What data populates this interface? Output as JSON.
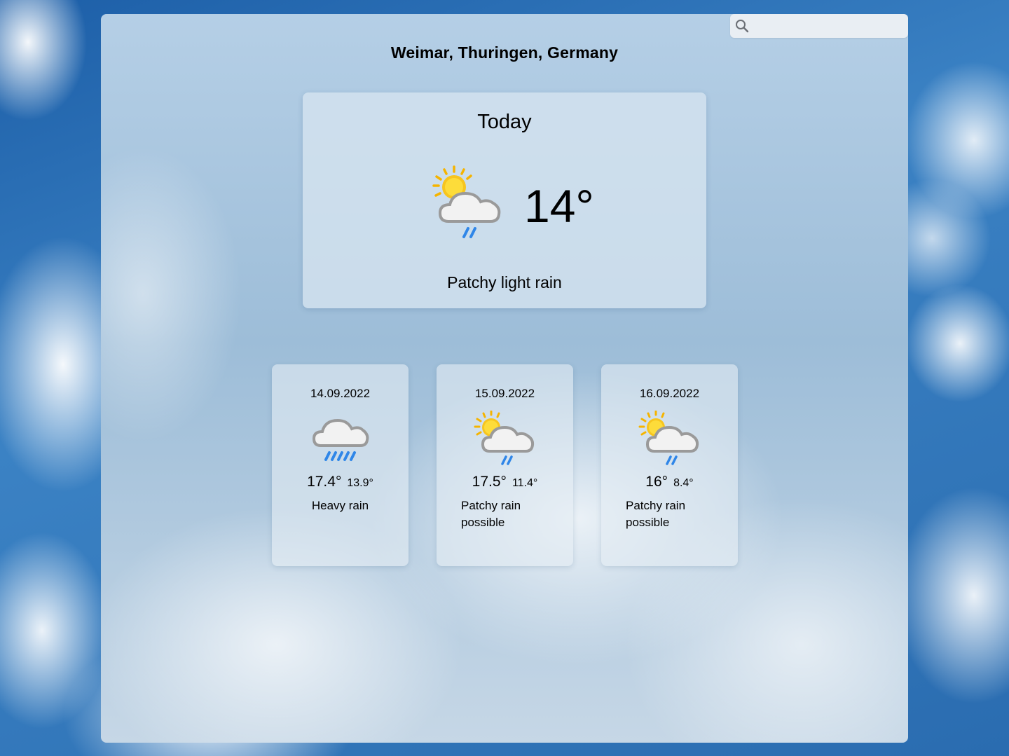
{
  "search": {
    "placeholder": "",
    "value": ""
  },
  "location": "Weimar, Thuringen, Germany",
  "today": {
    "title": "Today",
    "temperature": "14°",
    "condition": "Patchy light rain",
    "icon": "partly-cloudy-light-rain-icon"
  },
  "forecast": [
    {
      "date": "14.09.2022",
      "max": "17.4°",
      "min": "13.9°",
      "condition": "Heavy rain",
      "icon": "heavy-rain-icon"
    },
    {
      "date": "15.09.2022",
      "max": "17.5°",
      "min": "11.4°",
      "condition": "Patchy rain possible",
      "icon": "partly-cloudy-rain-icon"
    },
    {
      "date": "16.09.2022",
      "max": "16°",
      "min": "8.4°",
      "condition": "Patchy rain possible",
      "icon": "partly-cloudy-rain-icon"
    }
  ]
}
